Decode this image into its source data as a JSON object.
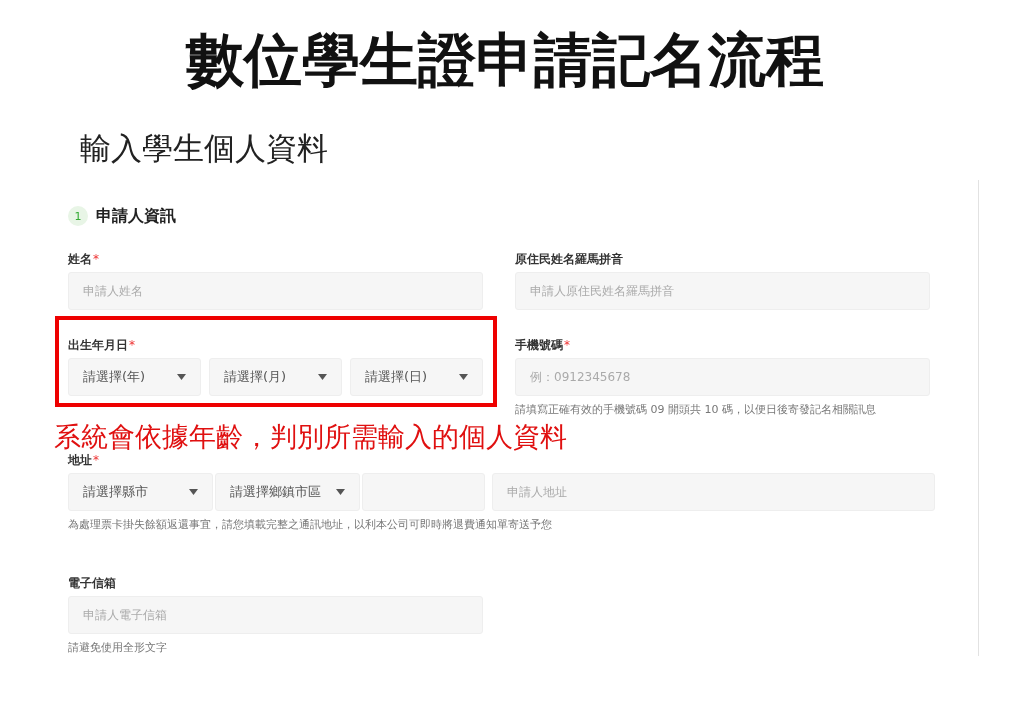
{
  "title": "數位學生證申請記名流程",
  "subtitle": "輸入學生個人資料",
  "section": {
    "number": "1",
    "title": "申請人資訊"
  },
  "rows": [
    {
      "kind": "pair",
      "fields": [
        {
          "kind": "text",
          "label": "姓名",
          "required_mark": "*",
          "placeholder": "申請人姓名"
        },
        {
          "kind": "text",
          "label": "原住民姓名羅馬拼音",
          "placeholder": "申請人原住民姓名羅馬拼音"
        }
      ]
    },
    {
      "kind": "pair",
      "fields": [
        {
          "kind": "selects",
          "label": "出生年月日",
          "required_mark": "*",
          "highlighted": true,
          "selects": [
            "請選擇(年)",
            "請選擇(月)",
            "請選擇(日)"
          ]
        },
        {
          "kind": "text",
          "label": "手機號碼",
          "required_mark": "*",
          "placeholder": "例：0912345678",
          "hint": "請填寫正確有效的手機號碼 09 開頭共 10 碼，以便日後寄發記名相關訊息"
        }
      ]
    },
    {
      "kind": "note",
      "text": "系統會依據年齡，判別所需輸入的個人資料"
    },
    {
      "kind": "address",
      "label": "地址",
      "required_mark": "*",
      "selects": [
        "請選擇縣市",
        "請選擇鄉鎮市區"
      ],
      "placeholder": "申請人地址",
      "hint": "為處理票卡掛失餘額返還事宜，請您填載完整之通訊地址，以利本公司可即時將退費通知單寄送予您"
    },
    {
      "kind": "single",
      "fields": [
        {
          "kind": "text",
          "label": "電子信箱",
          "placeholder": "申請人電子信箱",
          "hint": "請避免使用全形文字"
        }
      ]
    }
  ]
}
